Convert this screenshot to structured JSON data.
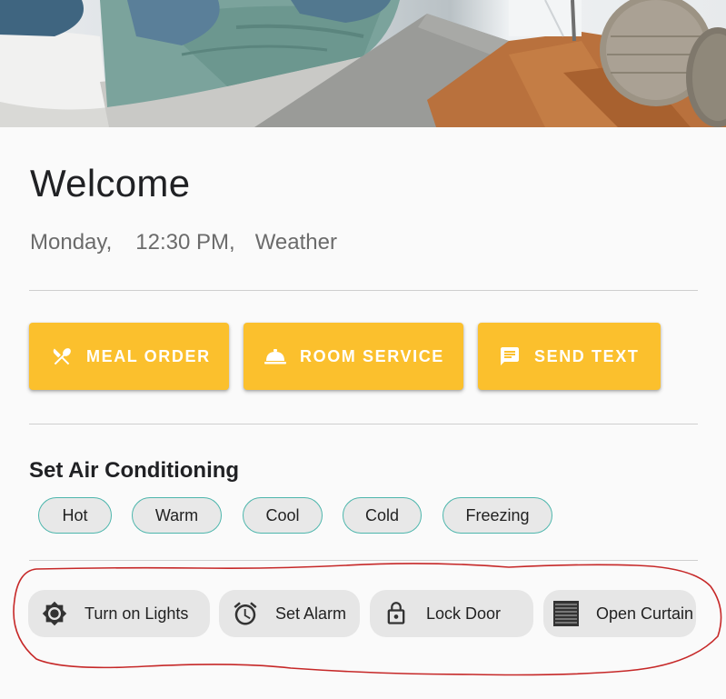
{
  "welcome": {
    "title": "Welcome"
  },
  "info": {
    "day": "Monday,",
    "time": "12:30 PM,",
    "weather": "Weather"
  },
  "actions": [
    {
      "label": "MEAL ORDER",
      "icon": "fork-knife-icon"
    },
    {
      "label": "ROOM SERVICE",
      "icon": "room-service-bell-icon"
    },
    {
      "label": "SEND TEXT",
      "icon": "message-icon"
    }
  ],
  "ac": {
    "title": "Set Air Conditioning",
    "options": [
      "Hot",
      "Warm",
      "Cool",
      "Cold",
      "Freezing"
    ]
  },
  "quick_actions": [
    {
      "label": "Turn on Lights",
      "icon": "brightness-icon"
    },
    {
      "label": "Set Alarm",
      "icon": "alarm-clock-icon"
    },
    {
      "label": "Lock Door",
      "icon": "lock-icon"
    },
    {
      "label": "Open Curtain",
      "icon": "blinds-icon"
    }
  ],
  "colors": {
    "accent": "#fbc02d",
    "chip_border": "#4db6ac",
    "annotation": "#c62828"
  }
}
